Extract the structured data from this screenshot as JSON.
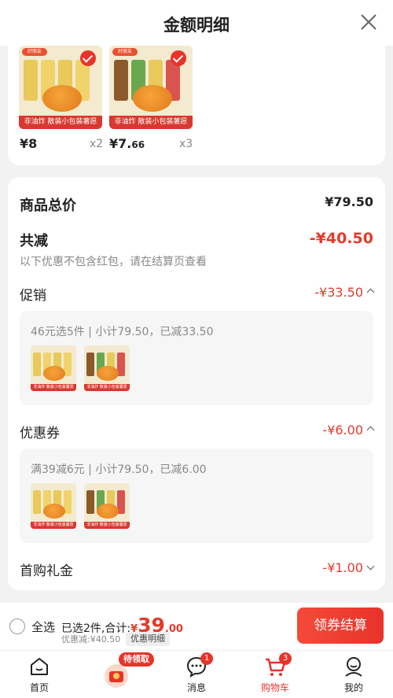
{
  "header": {
    "title": "金额明细"
  },
  "items": [
    {
      "price_symbol": "¥",
      "price_int": "8",
      "price_dec": "",
      "qty": "x2",
      "band": "非油炸 散装小包装薯愿",
      "logo": "好丽友"
    },
    {
      "price_symbol": "¥",
      "price_int": "7.",
      "price_dec": "66",
      "qty": "x3",
      "band": "非油炸 散装小包装薯愿",
      "logo": "好丽友"
    }
  ],
  "summary": {
    "total_label": "商品总价",
    "total_value": "¥79.50",
    "discount_label": "共减",
    "discount_value": "-¥40.50",
    "hint": "以下优惠不包含红包，请在结算页查看"
  },
  "promotion": {
    "label": "促销",
    "value": "-¥33.50",
    "detail": "46元选5件 | 小计79.50，已减33.50"
  },
  "coupon": {
    "label": "优惠券",
    "value": "-¥6.00",
    "detail": "满39减6元 | 小计79.50，已减6.00"
  },
  "first_gift": {
    "label": "首购礼金",
    "value": "-¥1.00"
  },
  "mini_band": "非油炸 散装小包装薯愿",
  "bottom": {
    "select_all": "全选",
    "selected": "已选2件,合计:",
    "currency": "¥",
    "amount_int": "39",
    "amount_dec": ".00",
    "saved": "优惠减:¥40.50",
    "detail_btn": "优惠明细",
    "checkout": "领券结算"
  },
  "tabs": [
    {
      "label": "首页"
    },
    {
      "label": "",
      "pill": "待领取"
    },
    {
      "label": "消息",
      "badge": "1"
    },
    {
      "label": "购物车",
      "badge": "3"
    },
    {
      "label": "我的"
    }
  ],
  "colors": {
    "accent": "#e8332a",
    "price_red": "#e33a2c"
  }
}
